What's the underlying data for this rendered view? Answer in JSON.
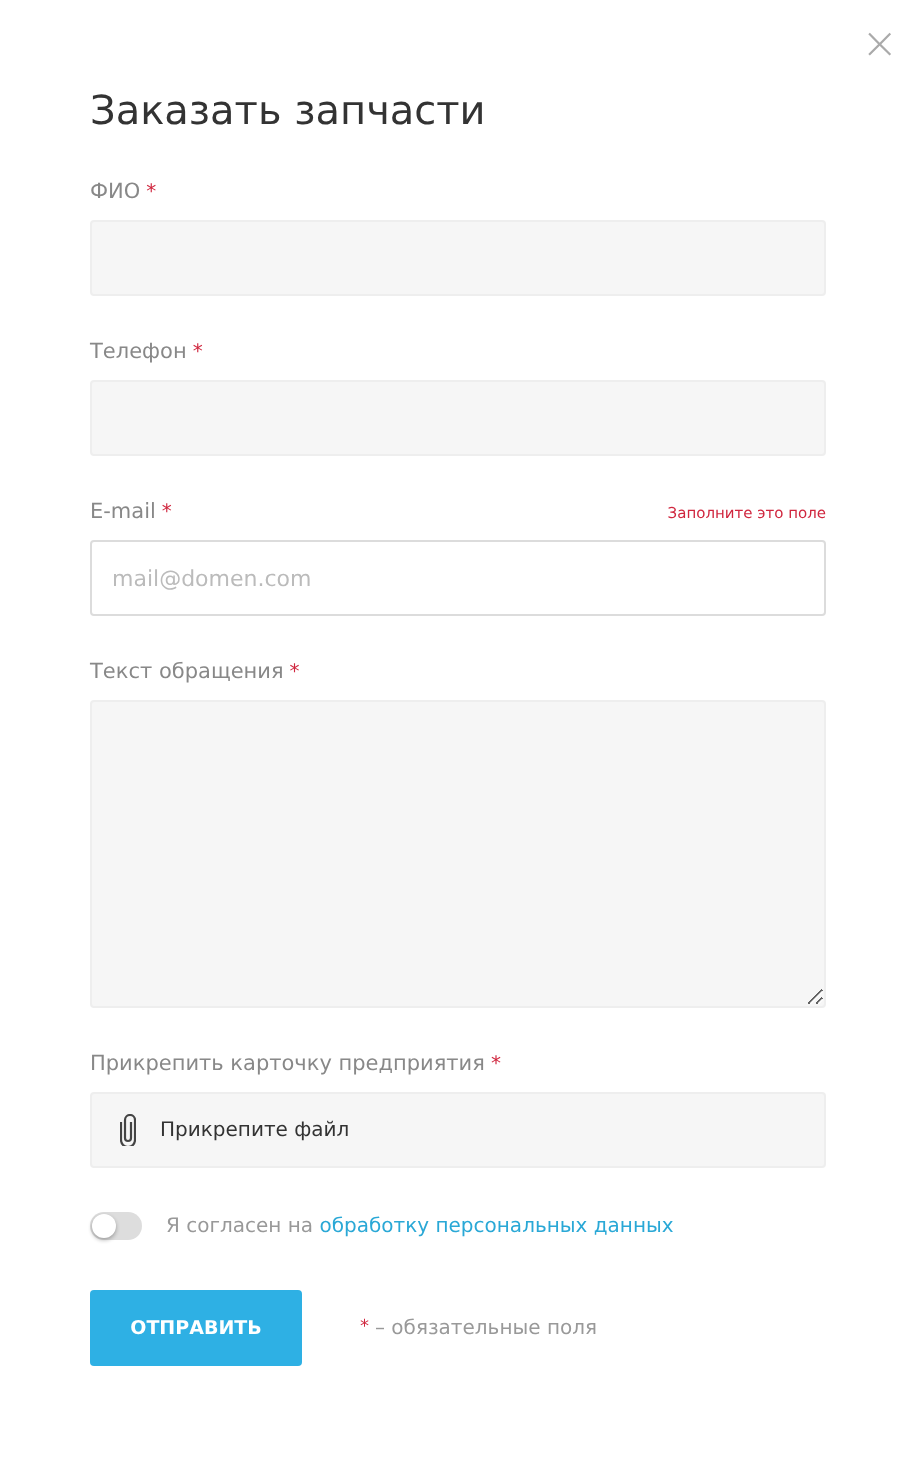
{
  "close_glyph": "×",
  "title": "Заказать запчасти",
  "fields": [
    {
      "kind": "text",
      "label": "ФИО",
      "required_mark": "*",
      "invalid": false
    },
    {
      "kind": "text",
      "label": "Телефон",
      "required_mark": "*",
      "invalid": false
    },
    {
      "kind": "text",
      "label": "E-mail",
      "required_mark": "*",
      "invalid": true,
      "error": "Заполните это поле",
      "placeholder": "mail@domen.com"
    },
    {
      "kind": "textarea",
      "label": "Текст обращения",
      "required_mark": "*",
      "invalid": false
    },
    {
      "kind": "file",
      "label": "Прикрепить карточку предприятия",
      "required_mark": "*",
      "invalid": false,
      "button": "Прикрепите файл"
    }
  ],
  "consent": {
    "on": false,
    "text": "Я согласен на",
    "link": "обработку персональных данных"
  },
  "submit": "ОТПРАВИТЬ",
  "note": {
    "mark": "*",
    "text": "– обязательные поля"
  }
}
